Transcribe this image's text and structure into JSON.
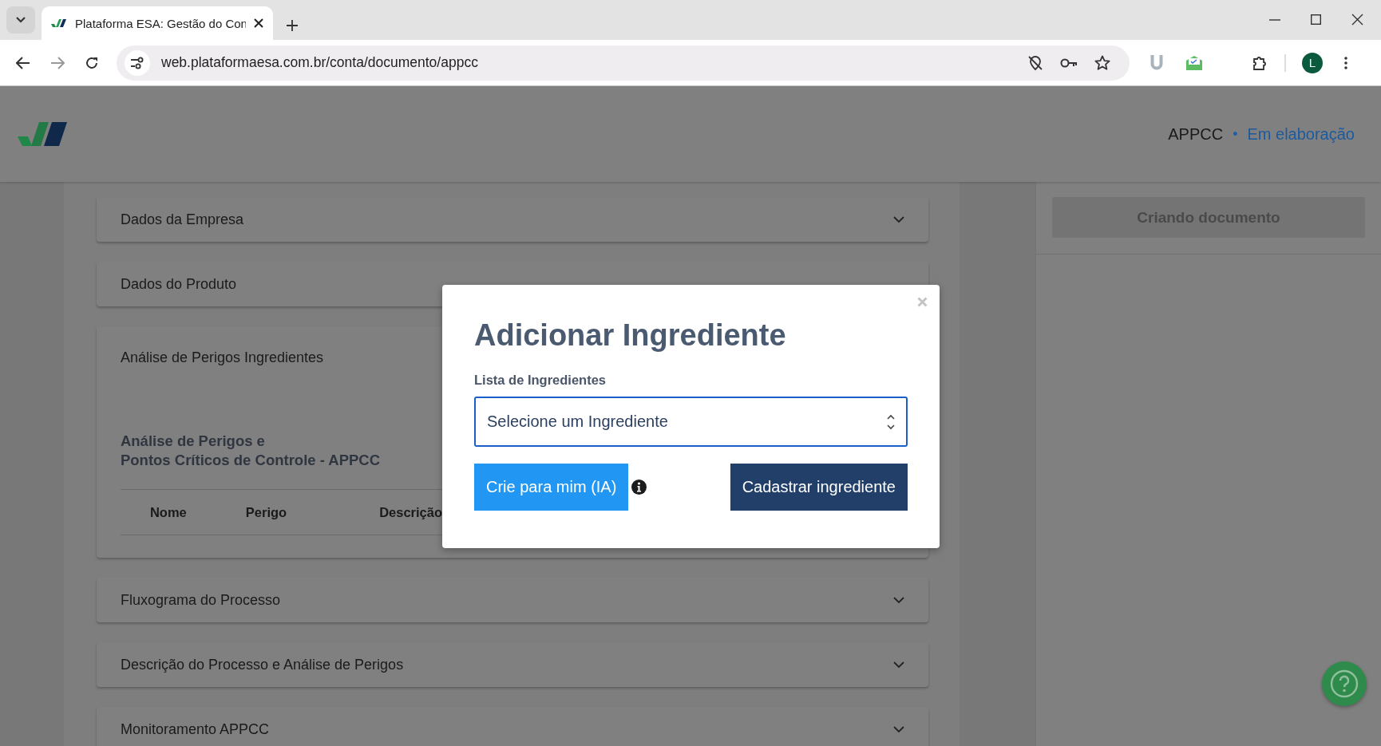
{
  "browser": {
    "tab_title": "Plataforma ESA: Gestão do Con",
    "url": "web.plataformaesa.com.br/conta/documento/appcc",
    "profile_initial": "L"
  },
  "header": {
    "document": "APPCC",
    "separator": "•",
    "status": "Em elaboração"
  },
  "sections": [
    {
      "title": "Dados da Empresa",
      "expanded": false
    },
    {
      "title": "Dados do Produto",
      "expanded": false
    },
    {
      "title": "Análise de Perigos Ingredientes",
      "expanded": true,
      "heading_lines": [
        "Análise de Perigos e",
        "Pontos Críticos de Controle - APPCC"
      ],
      "columns": [
        "Nome",
        "Perigo",
        "Descrição"
      ]
    },
    {
      "title": "Fluxograma do Processo",
      "expanded": false
    },
    {
      "title": "Descrição do Processo e Análise de Perigos",
      "expanded": false
    },
    {
      "title": "Monitoramento APPCC",
      "expanded": false
    }
  ],
  "sidebar": {
    "button": "Criando documento",
    "disabled": true
  },
  "modal": {
    "title": "Adicionar Ingrediente",
    "field_label": "Lista de Ingredientes",
    "select_placeholder": "Selecione um Ingrediente",
    "buttons": [
      {
        "label": "Crie para mim (IA)",
        "kind": "primary"
      },
      {
        "label": "Cadastrar ingrediente",
        "kind": "secondary"
      }
    ]
  }
}
